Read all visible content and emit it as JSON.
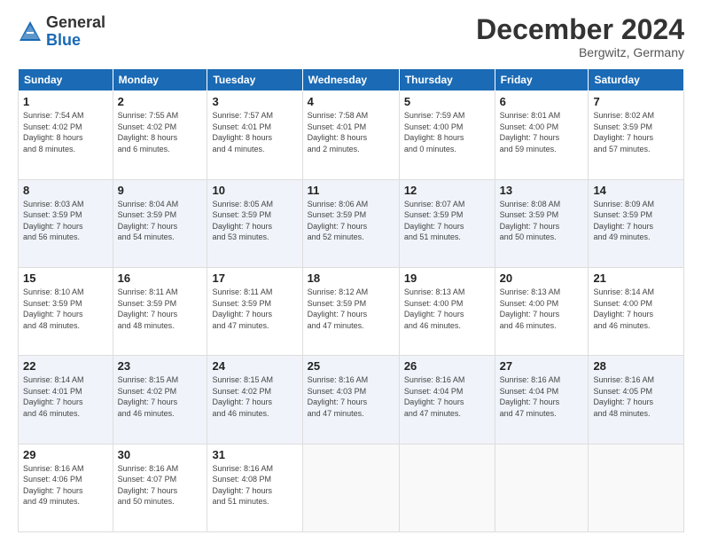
{
  "header": {
    "logo_general": "General",
    "logo_blue": "Blue",
    "month_title": "December 2024",
    "location": "Bergwitz, Germany"
  },
  "columns": [
    "Sunday",
    "Monday",
    "Tuesday",
    "Wednesday",
    "Thursday",
    "Friday",
    "Saturday"
  ],
  "weeks": [
    [
      {
        "day": "1",
        "info": "Sunrise: 7:54 AM\nSunset: 4:02 PM\nDaylight: 8 hours\nand 8 minutes."
      },
      {
        "day": "2",
        "info": "Sunrise: 7:55 AM\nSunset: 4:02 PM\nDaylight: 8 hours\nand 6 minutes."
      },
      {
        "day": "3",
        "info": "Sunrise: 7:57 AM\nSunset: 4:01 PM\nDaylight: 8 hours\nand 4 minutes."
      },
      {
        "day": "4",
        "info": "Sunrise: 7:58 AM\nSunset: 4:01 PM\nDaylight: 8 hours\nand 2 minutes."
      },
      {
        "day": "5",
        "info": "Sunrise: 7:59 AM\nSunset: 4:00 PM\nDaylight: 8 hours\nand 0 minutes."
      },
      {
        "day": "6",
        "info": "Sunrise: 8:01 AM\nSunset: 4:00 PM\nDaylight: 7 hours\nand 59 minutes."
      },
      {
        "day": "7",
        "info": "Sunrise: 8:02 AM\nSunset: 3:59 PM\nDaylight: 7 hours\nand 57 minutes."
      }
    ],
    [
      {
        "day": "8",
        "info": "Sunrise: 8:03 AM\nSunset: 3:59 PM\nDaylight: 7 hours\nand 56 minutes."
      },
      {
        "day": "9",
        "info": "Sunrise: 8:04 AM\nSunset: 3:59 PM\nDaylight: 7 hours\nand 54 minutes."
      },
      {
        "day": "10",
        "info": "Sunrise: 8:05 AM\nSunset: 3:59 PM\nDaylight: 7 hours\nand 53 minutes."
      },
      {
        "day": "11",
        "info": "Sunrise: 8:06 AM\nSunset: 3:59 PM\nDaylight: 7 hours\nand 52 minutes."
      },
      {
        "day": "12",
        "info": "Sunrise: 8:07 AM\nSunset: 3:59 PM\nDaylight: 7 hours\nand 51 minutes."
      },
      {
        "day": "13",
        "info": "Sunrise: 8:08 AM\nSunset: 3:59 PM\nDaylight: 7 hours\nand 50 minutes."
      },
      {
        "day": "14",
        "info": "Sunrise: 8:09 AM\nSunset: 3:59 PM\nDaylight: 7 hours\nand 49 minutes."
      }
    ],
    [
      {
        "day": "15",
        "info": "Sunrise: 8:10 AM\nSunset: 3:59 PM\nDaylight: 7 hours\nand 48 minutes."
      },
      {
        "day": "16",
        "info": "Sunrise: 8:11 AM\nSunset: 3:59 PM\nDaylight: 7 hours\nand 48 minutes."
      },
      {
        "day": "17",
        "info": "Sunrise: 8:11 AM\nSunset: 3:59 PM\nDaylight: 7 hours\nand 47 minutes."
      },
      {
        "day": "18",
        "info": "Sunrise: 8:12 AM\nSunset: 3:59 PM\nDaylight: 7 hours\nand 47 minutes."
      },
      {
        "day": "19",
        "info": "Sunrise: 8:13 AM\nSunset: 4:00 PM\nDaylight: 7 hours\nand 46 minutes."
      },
      {
        "day": "20",
        "info": "Sunrise: 8:13 AM\nSunset: 4:00 PM\nDaylight: 7 hours\nand 46 minutes."
      },
      {
        "day": "21",
        "info": "Sunrise: 8:14 AM\nSunset: 4:00 PM\nDaylight: 7 hours\nand 46 minutes."
      }
    ],
    [
      {
        "day": "22",
        "info": "Sunrise: 8:14 AM\nSunset: 4:01 PM\nDaylight: 7 hours\nand 46 minutes."
      },
      {
        "day": "23",
        "info": "Sunrise: 8:15 AM\nSunset: 4:02 PM\nDaylight: 7 hours\nand 46 minutes."
      },
      {
        "day": "24",
        "info": "Sunrise: 8:15 AM\nSunset: 4:02 PM\nDaylight: 7 hours\nand 46 minutes."
      },
      {
        "day": "25",
        "info": "Sunrise: 8:16 AM\nSunset: 4:03 PM\nDaylight: 7 hours\nand 47 minutes."
      },
      {
        "day": "26",
        "info": "Sunrise: 8:16 AM\nSunset: 4:04 PM\nDaylight: 7 hours\nand 47 minutes."
      },
      {
        "day": "27",
        "info": "Sunrise: 8:16 AM\nSunset: 4:04 PM\nDaylight: 7 hours\nand 47 minutes."
      },
      {
        "day": "28",
        "info": "Sunrise: 8:16 AM\nSunset: 4:05 PM\nDaylight: 7 hours\nand 48 minutes."
      }
    ],
    [
      {
        "day": "29",
        "info": "Sunrise: 8:16 AM\nSunset: 4:06 PM\nDaylight: 7 hours\nand 49 minutes."
      },
      {
        "day": "30",
        "info": "Sunrise: 8:16 AM\nSunset: 4:07 PM\nDaylight: 7 hours\nand 50 minutes."
      },
      {
        "day": "31",
        "info": "Sunrise: 8:16 AM\nSunset: 4:08 PM\nDaylight: 7 hours\nand 51 minutes."
      },
      {
        "day": "",
        "info": ""
      },
      {
        "day": "",
        "info": ""
      },
      {
        "day": "",
        "info": ""
      },
      {
        "day": "",
        "info": ""
      }
    ]
  ]
}
